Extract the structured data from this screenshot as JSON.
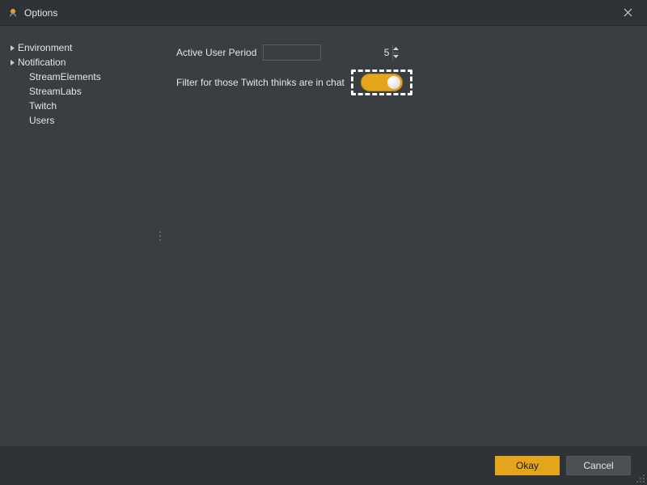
{
  "window": {
    "title": "Options",
    "close_tooltip": "Close"
  },
  "sidebar": {
    "items": [
      {
        "label": "Environment",
        "expandable": true
      },
      {
        "label": "Notification",
        "expandable": true
      },
      {
        "label": "StreamElements",
        "expandable": false,
        "child": true
      },
      {
        "label": "StreamLabs",
        "expandable": false,
        "child": true
      },
      {
        "label": "Twitch",
        "expandable": false,
        "child": true
      },
      {
        "label": "Users",
        "expandable": false,
        "child": true
      }
    ]
  },
  "content": {
    "active_user_period": {
      "label": "Active User Period",
      "value": "5"
    },
    "filter_chat": {
      "label": "Filter for those Twitch thinks are in chat",
      "enabled": true
    }
  },
  "footer": {
    "ok_label": "Okay",
    "cancel_label": "Cancel"
  },
  "colors": {
    "accent": "#e4a51d"
  }
}
